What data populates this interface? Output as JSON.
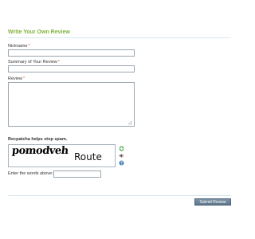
{
  "form": {
    "title": "Write Your Own Review",
    "required_mark": "*",
    "nickname": {
      "label": "Nickname",
      "value": ""
    },
    "summary": {
      "label": "Summary of Your Review",
      "value": ""
    },
    "review": {
      "label": "Review",
      "value": ""
    }
  },
  "captcha": {
    "heading": "Recpatcha helps stop spam.",
    "word1": "pomodveh",
    "word2": "Route",
    "words_label": "Enter the words above:",
    "words_value": "",
    "icons": [
      "refresh-icon",
      "audio-icon",
      "help-icon"
    ]
  },
  "actions": {
    "submit_label": "Submit Review"
  },
  "colors": {
    "title": "#7fb33b",
    "required": "#e05050",
    "button": "#6b8298"
  }
}
